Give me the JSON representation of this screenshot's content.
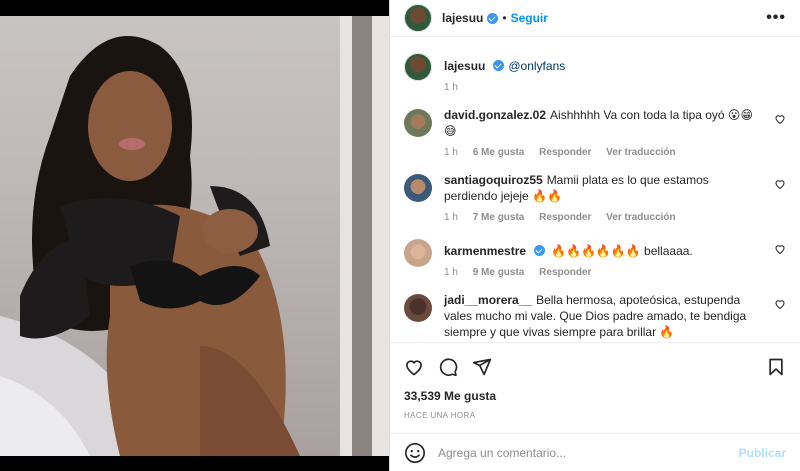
{
  "post": {
    "username": "lajesuu",
    "follow_label": "Seguir",
    "dot": "•",
    "more": "•••"
  },
  "caption": {
    "username": "lajesuu",
    "mention": "@onlyfans",
    "time": "1 h"
  },
  "comments": [
    {
      "username": "david.gonzalez.02",
      "text": "Aishhhhh Va con toda la tipa oyó 😮😁😅",
      "time": "1 h",
      "likes": "6 Me gusta",
      "reply": "Responder",
      "translate": "Ver traducción",
      "avatar_color": "#6d7a5a"
    },
    {
      "username": "santiagoquiroz55",
      "text": "Mamii plata es lo que estamos perdiendo jejeje 🔥🔥",
      "time": "1 h",
      "likes": "7 Me gusta",
      "reply": "Responder",
      "translate": "Ver traducción",
      "avatar_color": "#3b5a7a"
    },
    {
      "username": "karmenmestre",
      "text": "🔥🔥🔥🔥🔥🔥 bellaaaa.",
      "time": "1 h",
      "likes": "9 Me gusta",
      "reply": "Responder",
      "translate": "",
      "avatar_color": "#c8a58a"
    },
    {
      "username": "jadi__morera__",
      "text": "Bella hermosa, apoteósica, estupenda vales mucho mi vale. Que Dios padre amado, te bendiga siempre y que vivas siempre para brillar 🔥",
      "time": "",
      "likes": "",
      "reply": "",
      "translate": "",
      "avatar_color": "#6b4a3e"
    }
  ],
  "actions": {
    "likes": "33,539 Me gusta",
    "time": "HACE UNA HORA"
  },
  "composer": {
    "placeholder": "Agrega un comentario...",
    "publish": "Publicar"
  },
  "colors": {
    "accent": "#0095f6",
    "verified": "#3897f0",
    "muted": "#8e8e8e"
  }
}
